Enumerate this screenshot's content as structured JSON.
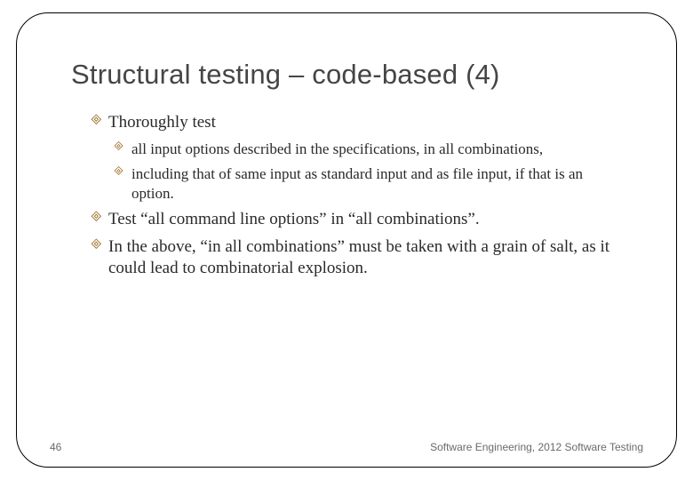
{
  "title": "Structural testing – code-based (4)",
  "bullets": {
    "b1": "Thoroughly test",
    "b1a": "all input options described in the specifications, in all combinations,",
    "b1b": "including that of same input as standard input and as file input, if that is an option.",
    "b2": " Test  “all command line options”  in “all combinations”.",
    "b3": " In the above, “in all combinations” must be taken with a grain of salt, as it could lead to combinatorial explosion."
  },
  "footer": {
    "pagenum": "46",
    "credit": "Software Engineering,   2012 Software  Testing"
  }
}
